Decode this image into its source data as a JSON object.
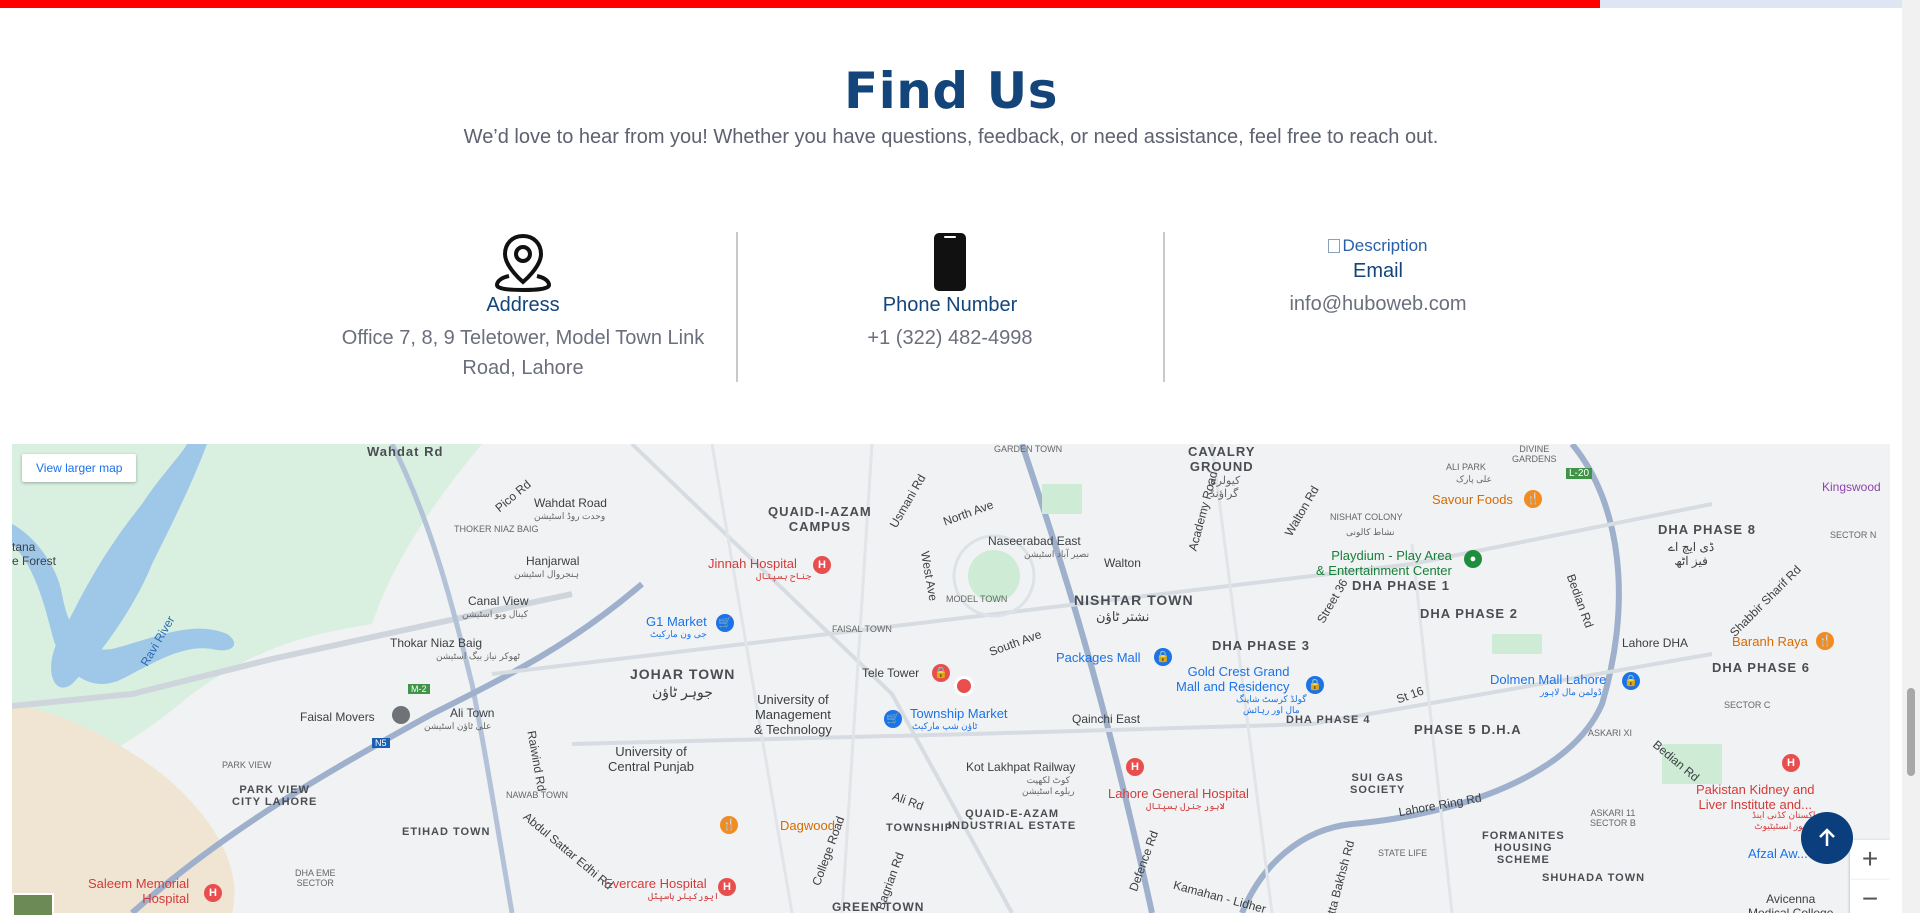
{
  "progress": {
    "percent": 84.1
  },
  "header": {
    "title": "Find Us",
    "subtitle": "We’d love to hear from you! Whether you have questions, feedback, or need assistance, feel free to reach out."
  },
  "contacts": [
    {
      "label": "Address",
      "icon": "location-pin-icon",
      "value_lines": [
        "Office 7, 8, 9 Teletower, Model Town Link",
        "Road, Lahore"
      ]
    },
    {
      "label": "Phone Number",
      "icon": "phone-icon",
      "value_lines": [
        "+1 (322) 482-4998"
      ]
    },
    {
      "label": "Email",
      "icon": "broken-image-icon",
      "icon_alt": "Description",
      "value_lines": [
        "info@huboweb.com"
      ]
    }
  ],
  "map": {
    "view_larger": "View larger map",
    "zoom_in": "+",
    "zoom_out": "−",
    "labels": {
      "wahdat_road": "Wahdat Road",
      "wahdat_road_ur": "وحدت روڈ اسٹیشن",
      "wahdat_rd": "Wahdat Rd",
      "pico_rd": "Pico Rd",
      "thoker_niaz_baig_area": "THOKER NIAZ BAIG",
      "hanjarwal": "Hanjarwal",
      "hanjarwal_ur": "ہنجروال اسٹیشن",
      "canal_view": "Canal View",
      "canal_view_ur": "کینال ویو اسٹیشن",
      "thokar_niaz_baig": "Thokar Niaz Baig",
      "thokar_ur": "ٹھوکر نیاز بیگ اسٹیشن",
      "faisal_movers": "Faisal Movers",
      "ali_town": "Ali Town",
      "ali_town_ur": "علی ٹاؤن اسٹیشن",
      "canal_rd": "Canal Rd",
      "park_view": "PARK VIEW",
      "park_view_city": "PARK VIEW\nCITY LAHORE",
      "etihad_town": "ETIHAD TOWN",
      "raiwind_rd": "Raiwind Rd",
      "nawab_town": "NAWAB TOWN",
      "abdul_sattar": "Abdul Sattar Edhi Rd",
      "saleem_memorial": "Saleem Memorial\nHospital",
      "saleem_ur": "سلیم میموریل ہسپتال",
      "dha_eme": "DHA EME\nSECTOR",
      "quaid_campus": "QUAID-I-AZAM\nCAMPUS",
      "jinnah_hospital": "Jinnah Hospital",
      "jinnah_ur": "جناح ہسپتال",
      "g1_market": "G1 Market",
      "g1_ur": "جی ون مارکیٹ",
      "johar_town": "JOHAR TOWN",
      "johar_ur": "جوہر ٹاؤن",
      "faisal_town": "FAISAL TOWN",
      "univ_mgmt": "University of\nManagement\n& Technology",
      "univ_punjab": "University of\nCentral Punjab",
      "dagwood": "Dagwood",
      "evercare": "Evercare Hospital",
      "evercare_ur": "ایورکیئر ہاسپٹل",
      "college_road": "College Road",
      "green_town": "GREEN TOWN",
      "usmani_rd": "Usmani Rd",
      "north_ave": "North Ave",
      "west_ave": "West Ave",
      "model_town": "MODEL TOWN",
      "south_ave": "South Ave",
      "tele_tower": "Tele Tower",
      "township_market": "Township Market",
      "township_ur": "ٹاؤن شپ مارکیٹ",
      "township": "TOWNSHIP",
      "quaid_e_azam_ind": "QUAID-E-AZAM\nINDUSTRIAL ESTATE",
      "ali_rd": "Ali Rd",
      "bagrian_rd": "Bagrian Rd",
      "garden_town": "GARDEN TOWN",
      "naseerabad": "Naseerabad East",
      "naseerabad_ur": "نصیر آباد اسٹیشن",
      "walton": "Walton",
      "nishtar_town": "NISHTAR TOWN",
      "nishtar_ur": "نشتر ٹاؤن",
      "packages_mall": "Packages Mall",
      "qainchi_east": "Qainchi East",
      "kot_lakhpat": "Kot Lakhpat Railway",
      "kot_ur": "کوٹ لکھپت\nریلوے اسٹیشن",
      "lahore_general": "Lahore General Hospital",
      "lahore_general_ur": "لاہور جنرل ہسپتال",
      "defence_rd": "Defence Rd",
      "kamahan": "Kamahan - Lidher",
      "cavalry_ground": "CAVALRY\nGROUND",
      "cavalry_ur": "کیولری\nگراؤنڈ",
      "academy_road": "Academy Road",
      "walton_rd": "Walton Rd",
      "dha_phase3": "DHA PHASE 3",
      "gold_crest": "Gold Crest Grand\nMall and Residency",
      "gold_crest_ur": "گولڈ کرسٹ شاپنگ\nمال اور رہائش",
      "dha_phase4": "DHA PHASE 4",
      "nishat_colony": "NISHAT COLONY",
      "nishat_ur": "نشاط کالونی",
      "playdium": "Playdium - Play Area\n& Entertainment Center",
      "dha_phase1": "DHA PHASE 1",
      "dha_phase2": "DHA PHASE 2",
      "street36": "Street 36",
      "st16": "St 16",
      "phase5": "PHASE 5 D.H.A",
      "sui_gas": "SUI GAS\nSOCIETY",
      "lahore_ring": "Lahore Ring Rd",
      "formanites": "FORMANITES\nHOUSING\nSCHEME",
      "state_life": "STATE LIFE",
      "atta_bakhsh": "Atta Bakhsh Rd",
      "shuhada_town": "SHUHADA TOWN",
      "ali_park": "ALI PARK",
      "ali_park_ur": "علی پارک",
      "divine_gardens": "DIVINE\nGARDENS",
      "savour_foods": "Savour Foods",
      "dha_phase8": "DHA PHASE 8",
      "dha8_ur": "ڈی ایچ اے\nفیز اٹھ",
      "bedian_rd": "Bedian Rd",
      "kingswood": "Kingswood",
      "sector_n": "SECTOR N",
      "shabbir_sharif": "Shabbir Sharif Rd",
      "lahore_dha": "Lahore DHA",
      "baranh_raya": "Baranh Raya",
      "dha_phase6": "DHA PHASE 6",
      "dolmen_mall": "Dolmen Mall Lahore",
      "dolmen_ur": "ڈولمن مال لاہور",
      "sector_c": "SECTOR C",
      "askari_xi": "ASKARI XI",
      "askari_11b": "ASKARI 11\nSECTOR B",
      "bedian_rd2": "Bedian Rd",
      "pakistan_kidney": "Pakistan Kidney and\nLiver Institute and...",
      "pak_kidney_ur": "پاکستان کڈنی اینڈ\nلیور انسٹیٹیوٹ...",
      "afzal_aw": "Afzal Aw...",
      "avicenna": "Avicenna\nMedical College",
      "l20": "L-20",
      "tana": "tana\ne Forest",
      "ravi_river": "Ravi River",
      "m2": "M-2",
      "n5": "N5"
    }
  }
}
